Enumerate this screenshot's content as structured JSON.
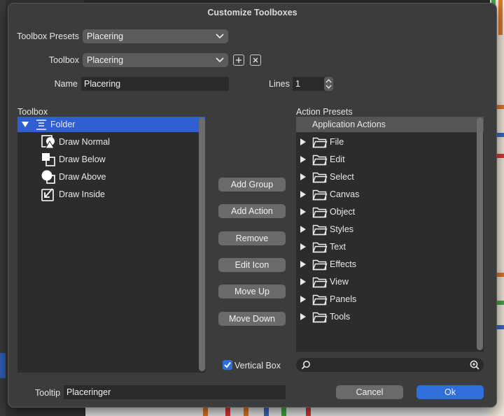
{
  "dialog": {
    "title": "Customize Toolboxes"
  },
  "form": {
    "presets_label": "Toolbox Presets",
    "presets_value": "Placering",
    "toolbox_label": "Toolbox",
    "toolbox_value": "Placering",
    "name_label": "Name",
    "name_value": "Placering",
    "lines_label": "Lines",
    "lines_value": "1",
    "tooltip_label": "Tooltip",
    "tooltip_value": "Placeringer"
  },
  "toolbox": {
    "label": "Toolbox",
    "folder": "Folder",
    "items": [
      "Draw Normal",
      "Draw Below",
      "Draw Above",
      "Draw Inside"
    ]
  },
  "actions": {
    "add_group": "Add Group",
    "add_action": "Add Action",
    "remove": "Remove",
    "edit_icon": "Edit Icon",
    "move_up": "Move Up",
    "move_down": "Move Down",
    "vertical_box": "Vertical Box"
  },
  "presets": {
    "label": "Action Presets",
    "header": "Application Actions",
    "items": [
      "File",
      "Edit",
      "Select",
      "Canvas",
      "Object",
      "Styles",
      "Text",
      "Effects",
      "View",
      "Panels",
      "Tools"
    ]
  },
  "footer": {
    "cancel": "Cancel",
    "ok": "Ok"
  },
  "colors": {
    "accent": "#2f6fdb",
    "selection": "#2f5fd0"
  }
}
